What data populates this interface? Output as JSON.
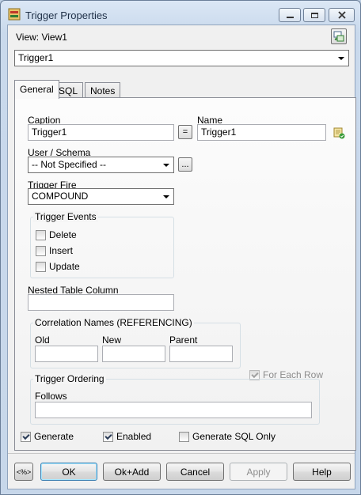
{
  "window": {
    "title": "Trigger Properties"
  },
  "view": {
    "label": "View: View1"
  },
  "object_selector": {
    "value": "Trigger1"
  },
  "tabs": [
    {
      "label": "General"
    },
    {
      "label": "SQL"
    },
    {
      "label": "Notes"
    }
  ],
  "general": {
    "caption_label": "Caption",
    "caption_value": "Trigger1",
    "equals_label": "=",
    "name_label": "Name",
    "name_value": "Trigger1",
    "user_schema_label": "User / Schema",
    "user_schema_value": "-- Not Specified --",
    "browse_label": "...",
    "trigger_fire_label": "Trigger Fire",
    "trigger_fire_value": "COMPOUND",
    "trigger_events": {
      "title": "Trigger Events",
      "delete": "Delete",
      "insert": "Insert",
      "update": "Update"
    },
    "nested_table_label": "Nested Table Column",
    "nested_table_value": "",
    "correlation": {
      "title": "Correlation Names (REFERENCING)",
      "old_label": "Old",
      "new_label": "New",
      "parent_label": "Parent",
      "old_value": "",
      "new_value": "",
      "parent_value": ""
    },
    "for_each_row": "For Each Row",
    "ordering": {
      "title": "Trigger Ordering",
      "follows_label": "Follows",
      "follows_value": ""
    },
    "generate": "Generate",
    "enabled": "Enabled",
    "generate_sql_only": "Generate SQL Only"
  },
  "buttons": {
    "macro": "<%>",
    "ok": "OK",
    "ok_add": "Ok+Add",
    "cancel": "Cancel",
    "apply": "Apply",
    "help": "Help"
  }
}
